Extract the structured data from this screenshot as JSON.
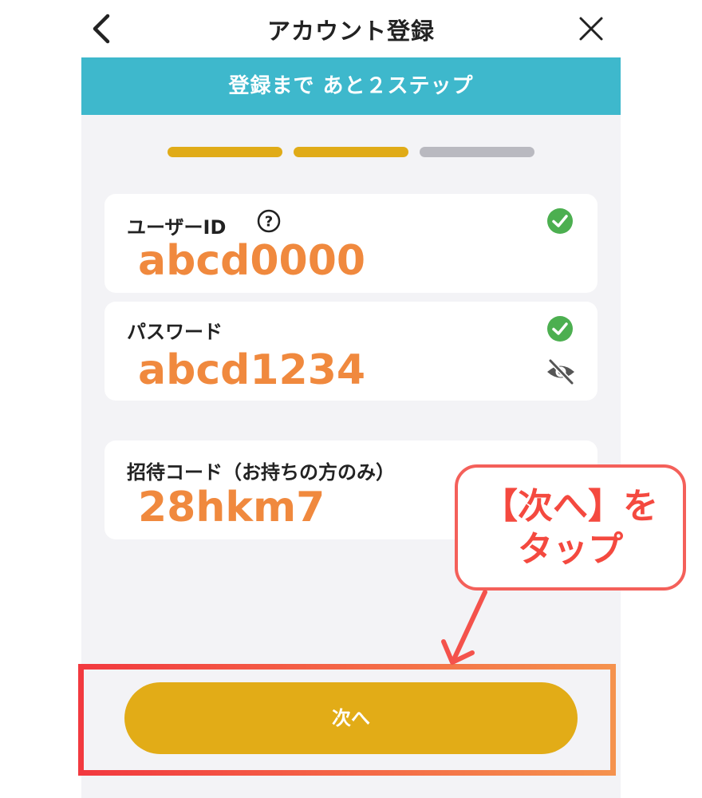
{
  "header": {
    "title": "アカウント登録",
    "back_icon": "chevron-left-icon",
    "close_icon": "close-icon"
  },
  "banner": {
    "text": "登録まで あと２ステップ",
    "color": "#3eb8cc"
  },
  "progress": {
    "total_steps": 3,
    "completed_steps": 2,
    "active_color": "#e0ab18",
    "inactive_color": "#b9b9c0"
  },
  "form": {
    "user_id": {
      "label": "ユーザーID",
      "value": "abcd0000",
      "valid": true
    },
    "password": {
      "label": "パスワード",
      "value": "abcd1234",
      "valid": true
    },
    "invite_code": {
      "label": "招待コード（お持ちの方のみ）",
      "value": "28hkm7"
    }
  },
  "next_button": {
    "label": "次へ",
    "color": "#e2ac17"
  },
  "callout": {
    "line1": "【次へ】を",
    "line2": "タップ",
    "color": "#f4493f"
  },
  "colors": {
    "value_text": "#f0893e",
    "check": "#4caf50"
  }
}
